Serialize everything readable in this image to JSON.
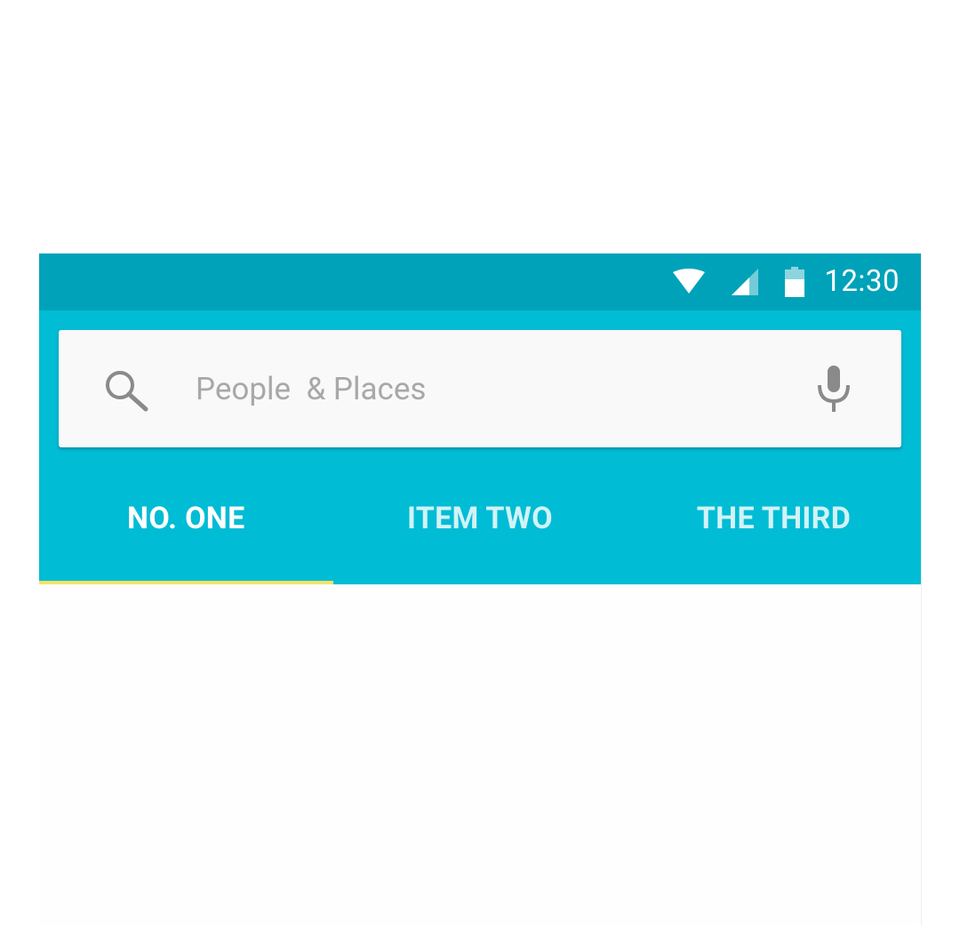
{
  "status_bar": {
    "time": "12:30",
    "icons": [
      "wifi-icon",
      "signal-icon",
      "battery-icon"
    ]
  },
  "search": {
    "placeholder": "People  & Places",
    "value": "",
    "leading_icon": "search-icon",
    "trailing_icon": "mic-icon"
  },
  "tabs": [
    {
      "label": "NO. ONE",
      "selected": true
    },
    {
      "label": "ITEM TWO",
      "selected": false
    },
    {
      "label": "THE THIRD",
      "selected": false
    }
  ],
  "colors": {
    "status_bar": "#00a2b9",
    "toolbar": "#00bcd4",
    "tab_indicator": "#f4e36a",
    "search_background": "#f9f9f9"
  }
}
